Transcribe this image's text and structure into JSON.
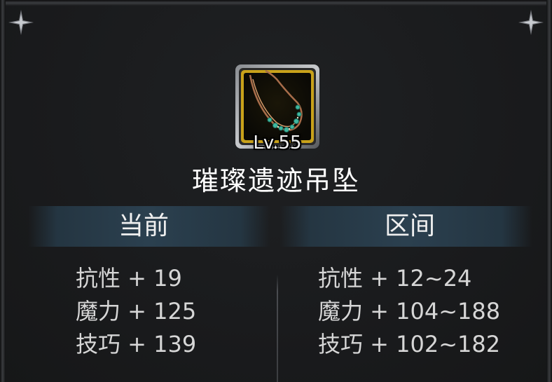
{
  "item": {
    "level": "Lv.55",
    "name": "璀璨遗迹吊坠",
    "icon": "necklace-icon",
    "frame_color": "#c9a21a"
  },
  "headers": {
    "current": "当前",
    "range": "区间"
  },
  "current_stats": [
    "抗性 + 19",
    "魔力 + 125",
    "技巧 + 139"
  ],
  "range_stats": [
    "抗性 + 12~24",
    "魔力 + 104~188",
    "技巧 + 102~182"
  ]
}
